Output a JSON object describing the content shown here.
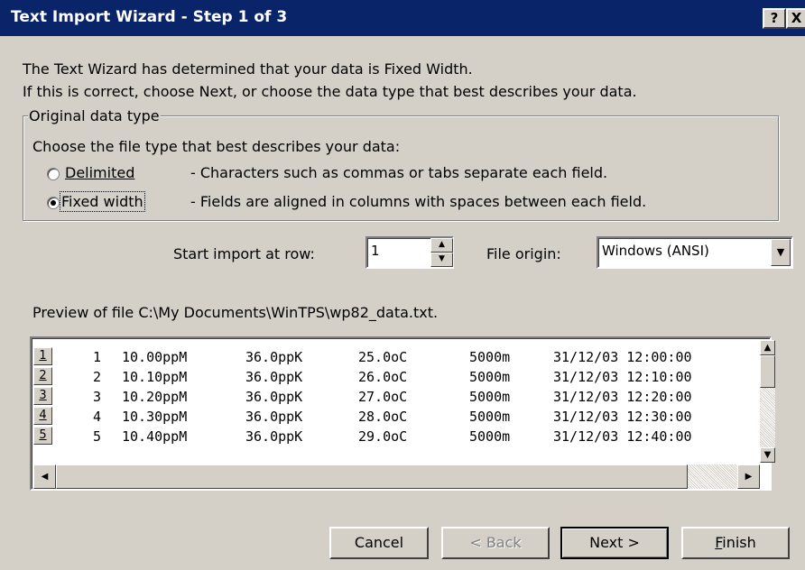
{
  "window": {
    "title": "Text Import Wizard - Step 1 of 3",
    "help_icon": "?",
    "close_icon": "X"
  },
  "intro": {
    "line1": "The Text Wizard has determined that your data is Fixed Width.",
    "line2": "If this is correct, choose Next, or choose the data type that best describes your data."
  },
  "original_data_type": {
    "legend": "Original data type",
    "prompt": "Choose the file type that best describes your data:",
    "options": [
      {
        "label": "Delimited",
        "description": "- Characters such as commas or tabs separate each field.",
        "selected": false
      },
      {
        "label": "Fixed width",
        "description": "- Fields are aligned in columns with spaces between each field.",
        "selected": true
      }
    ]
  },
  "start_import": {
    "label": "Start import at row:",
    "value": "1"
  },
  "file_origin": {
    "label": "File origin:",
    "value": "Windows (ANSI)"
  },
  "preview": {
    "label": "Preview of file C:\\My Documents\\WinTPS\\wp82_data.txt.",
    "rows": [
      {
        "num": "1",
        "cells": [
          "1",
          "10.00ppM",
          "36.0ppK",
          "25.0oC",
          "5000m",
          "31/12/03 12:00:00"
        ]
      },
      {
        "num": "2",
        "cells": [
          "2",
          "10.10ppM",
          "36.0ppK",
          "26.0oC",
          "5000m",
          "31/12/03 12:10:00"
        ]
      },
      {
        "num": "3",
        "cells": [
          "3",
          "10.20ppM",
          "36.0ppK",
          "27.0oC",
          "5000m",
          "31/12/03 12:20:00"
        ]
      },
      {
        "num": "4",
        "cells": [
          "4",
          "10.30ppM",
          "36.0ppK",
          "28.0oC",
          "5000m",
          "31/12/03 12:30:00"
        ]
      },
      {
        "num": "5",
        "cells": [
          "5",
          "10.40ppM",
          "36.0ppK",
          "29.0oC",
          "5000m",
          "31/12/03 12:40:00"
        ]
      }
    ]
  },
  "buttons": {
    "cancel": "Cancel",
    "back": "< Back",
    "next": "Next >",
    "finish": "Finish"
  },
  "icons": {
    "spin_up": "up-arrow-icon",
    "spin_down": "down-arrow-icon",
    "dropdown": "chevron-down-icon",
    "scroll_up": "scroll-up-icon",
    "scroll_down": "scroll-down-icon",
    "scroll_left": "scroll-left-icon",
    "scroll_right": "scroll-right-icon"
  }
}
